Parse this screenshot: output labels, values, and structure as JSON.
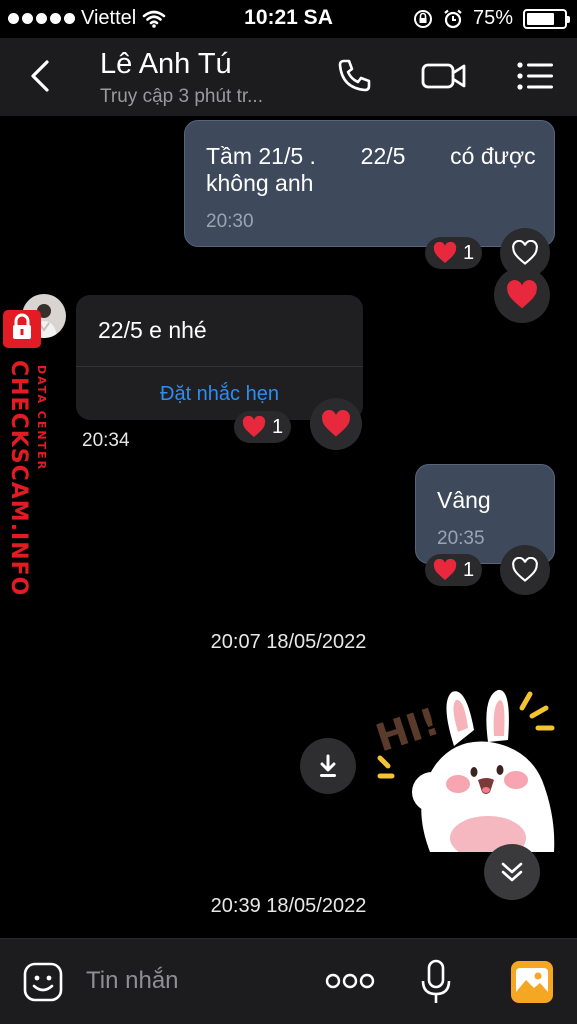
{
  "status_bar": {
    "carrier": "Viettel",
    "time": "10:21 SA",
    "battery": "75%",
    "battery_level": 0.75
  },
  "header": {
    "contact_name": "Lê Anh Tú",
    "status": "Truy cập 3 phút tr..."
  },
  "messages": [
    {
      "direction": "outgoing",
      "text": "Tầm 21/5 .       22/5       có được không anh",
      "time": "20:30",
      "reaction_count": "1"
    },
    {
      "direction": "incoming",
      "text": "22/5 e nhé",
      "action": "Đặt nhắc hẹn",
      "time": "20:34",
      "reaction_count": "1"
    },
    {
      "direction": "outgoing",
      "text": "Vâng",
      "time": "20:35",
      "reaction_count": "1"
    }
  ],
  "date_separators": [
    "20:07 18/05/2022",
    "20:39 18/05/2022"
  ],
  "sticker": {
    "text": "HI!"
  },
  "watermark": {
    "brand": "CHECKSCAM.INFO",
    "sub": "DATA CENTER"
  },
  "composer": {
    "placeholder": "Tin nhắn"
  },
  "colors": {
    "outgoing_bubble": "#3e4a5c",
    "incoming_bubble": "#1f1f22",
    "link": "#2f8cf0",
    "heart": "#e8283c",
    "watermark": "#e31b23",
    "gallery_accent": "#f5a623"
  }
}
